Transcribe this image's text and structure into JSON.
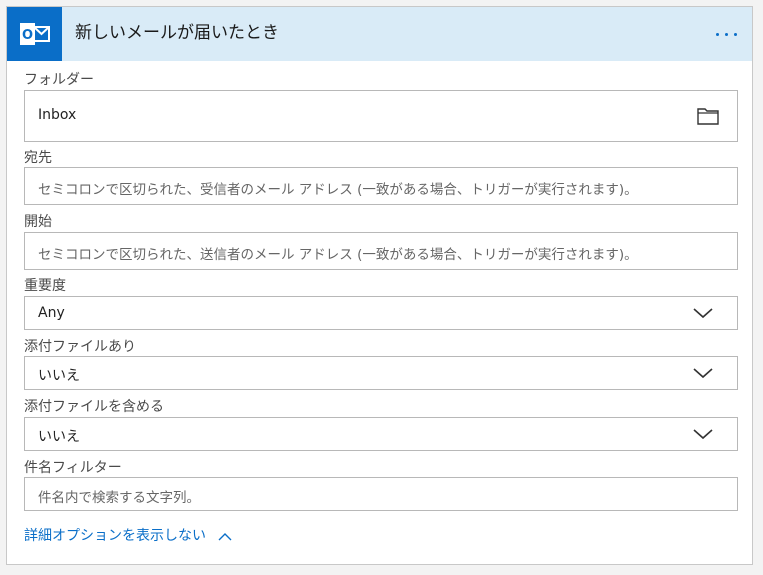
{
  "header": {
    "title": "新しいメールが届いたとき"
  },
  "fields": {
    "folder": {
      "label": "フォルダー",
      "value": "Inbox"
    },
    "to": {
      "label": "宛先",
      "placeholder": "セミコロンで区切られた、受信者のメール アドレス (一致がある場合、トリガーが実行されます)。"
    },
    "from": {
      "label": "開始",
      "placeholder": "セミコロンで区切られた、送信者のメール アドレス (一致がある場合、トリガーが実行されます)。"
    },
    "importance": {
      "label": "重要度",
      "value": "Any"
    },
    "has_attachment": {
      "label": "添付ファイルあり",
      "value": "いいえ"
    },
    "include_attachments": {
      "label": "添付ファイルを含める",
      "value": "いいえ"
    },
    "subject_filter": {
      "label": "件名フィルター",
      "placeholder": "件名内で検索する文字列。"
    }
  },
  "advanced_link": "詳細オプションを表示しない",
  "colors": {
    "accent": "#0a6ec8",
    "header_bg": "#d9ebf7"
  },
  "icons": [
    "outlook-icon",
    "more-icon",
    "folder-icon",
    "chevron-down-icon",
    "chevron-up-icon"
  ]
}
